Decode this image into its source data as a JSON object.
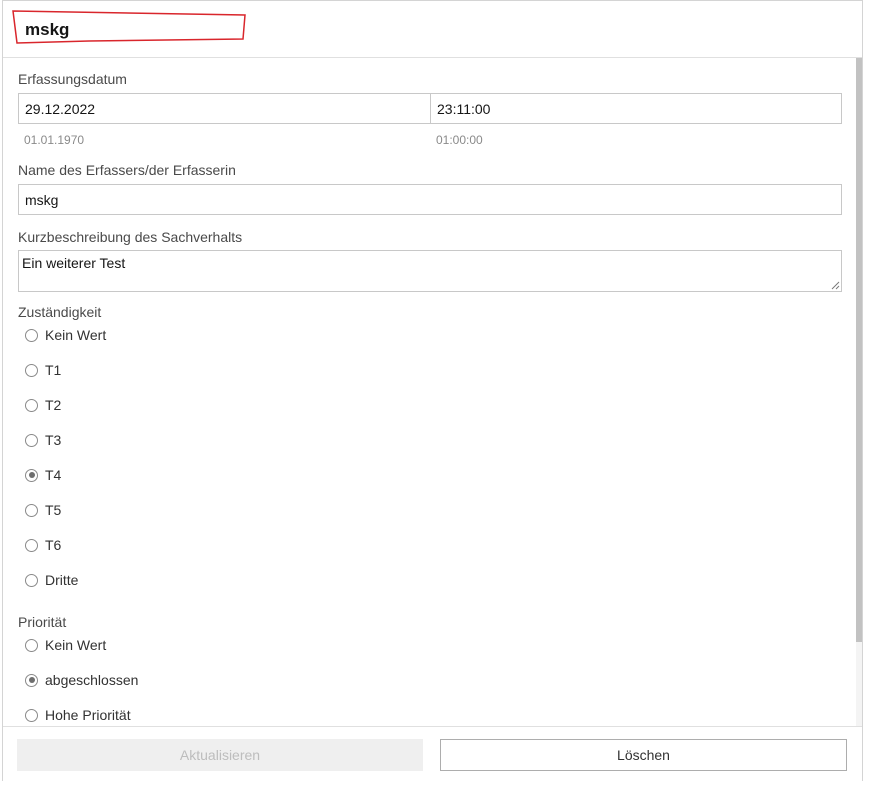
{
  "header": {
    "title": "mskg"
  },
  "form": {
    "erfassungsdatum": {
      "label": "Erfassungsdatum",
      "date_value": "29.12.2022",
      "time_value": "23:11:00",
      "date_hint": "01.01.1970",
      "time_hint": "01:00:00"
    },
    "erfasser": {
      "label": "Name des Erfassers/der Erfasserin",
      "value": "mskg"
    },
    "kurzbeschreibung": {
      "label": "Kurzbeschreibung des Sachverhalts",
      "value": "Ein weiterer Test"
    },
    "zustaendigkeit": {
      "label": "Zuständigkeit",
      "options": [
        {
          "label": "Kein Wert",
          "checked": false
        },
        {
          "label": "T1",
          "checked": false
        },
        {
          "label": "T2",
          "checked": false
        },
        {
          "label": "T3",
          "checked": false
        },
        {
          "label": "T4",
          "checked": true
        },
        {
          "label": "T5",
          "checked": false
        },
        {
          "label": "T6",
          "checked": false
        },
        {
          "label": "Dritte",
          "checked": false
        }
      ]
    },
    "prioritaet": {
      "label": "Priorität",
      "options": [
        {
          "label": "Kein Wert",
          "checked": false
        },
        {
          "label": "abgeschlossen",
          "checked": true
        },
        {
          "label": "Hohe Priorität",
          "checked": false
        }
      ]
    }
  },
  "footer": {
    "update_label": "Aktualisieren",
    "delete_label": "Löschen"
  },
  "colors": {
    "highlight_red": "#d9262c",
    "disabled_bg": "#efefef",
    "disabled_text": "#bdbdbd"
  }
}
